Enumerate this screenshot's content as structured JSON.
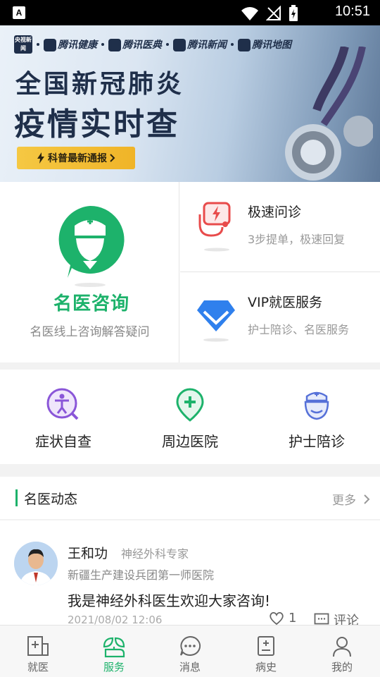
{
  "status_bar": {
    "time": "10:51",
    "app_icon": "A"
  },
  "banner": {
    "partners": [
      "央视新闻",
      "腾讯健康",
      "腾讯医典",
      "腾讯新闻",
      "腾讯地图"
    ],
    "headline1": "全国新冠肺炎",
    "headline2": "疫情实时查",
    "cta": "科普最新通报",
    "cta_icon": "lightning-icon",
    "colors": {
      "text": "#1f2f4a",
      "cta": "#f5c843"
    }
  },
  "consult": {
    "main": {
      "title": "名医咨询",
      "subtitle": "名医线上咨询解答疑问",
      "icon": "nurse-chat-icon"
    },
    "items": [
      {
        "title": "极速问诊",
        "subtitle": "3步提单，极速回复",
        "icon": "stethoscope-lightning-icon"
      },
      {
        "title": "VIP就医服务",
        "subtitle": "护士陪诊、名医服务",
        "icon": "diamond-icon"
      }
    ]
  },
  "shortcuts": [
    {
      "label": "症状自查",
      "icon": "body-search-icon"
    },
    {
      "label": "周边医院",
      "icon": "hospital-pin-icon"
    },
    {
      "label": "护士陪诊",
      "icon": "nurse-icon"
    }
  ],
  "news": {
    "header": "名医动态",
    "more": "更多",
    "post": {
      "name": "王和功",
      "title": "神经外科专家",
      "hospital": "新疆生产建设兵团第一师医院",
      "message": "我是神经外科医生欢迎大家咨询!",
      "date": "2021/08/02 12:06",
      "likes": "1",
      "comments_label": "评论"
    }
  },
  "tabbar": {
    "active": "服务",
    "tabs": [
      {
        "label": "就医",
        "icon": "hospital-tab-icon"
      },
      {
        "label": "服务",
        "icon": "service-leaf-icon"
      },
      {
        "label": "消息",
        "icon": "message-icon"
      },
      {
        "label": "病史",
        "icon": "medical-record-icon"
      },
      {
        "label": "我的",
        "icon": "profile-icon"
      }
    ]
  },
  "colors": {
    "accent": "#1db26b",
    "secondary_text": "#999999"
  }
}
